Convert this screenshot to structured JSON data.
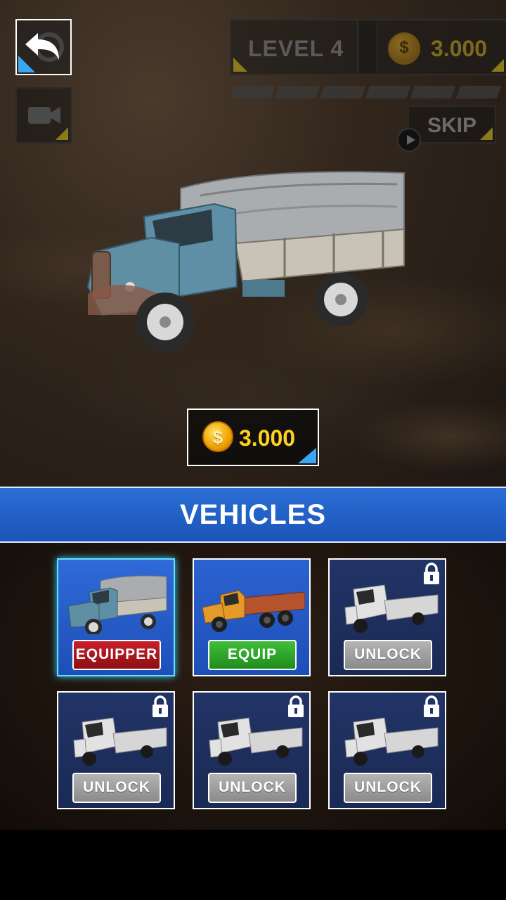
{
  "hud": {
    "level_label": "LEVEL 4",
    "coins": "3.000",
    "skip_label": "SKIP",
    "coin_symbol": "$"
  },
  "hero": {
    "price": "3.000",
    "coin_symbol": "$"
  },
  "vehicles": {
    "title": "VEHICLES",
    "cards": [
      {
        "kind": "covered-truck",
        "button": "EQUIPPER",
        "state": "equipped",
        "locked": false
      },
      {
        "kind": "orange-flatbed-truck",
        "button": "EQUIP",
        "state": "owned",
        "locked": false
      },
      {
        "kind": "white-pickup",
        "button": "UNLOCK",
        "state": "locked",
        "locked": true
      },
      {
        "kind": "white-pickup",
        "button": "UNLOCK",
        "state": "locked",
        "locked": true
      },
      {
        "kind": "white-pickup",
        "button": "UNLOCK",
        "state": "locked",
        "locked": true
      },
      {
        "kind": "white-pickup",
        "button": "UNLOCK",
        "state": "locked",
        "locked": true
      }
    ]
  },
  "colors": {
    "accent_blue": "#2a6fd6",
    "coin_gold": "#ffd21f",
    "equipped_red": "#c8202a",
    "equip_green": "#3fbf3a",
    "unlock_grey": "#9e9e9e"
  }
}
